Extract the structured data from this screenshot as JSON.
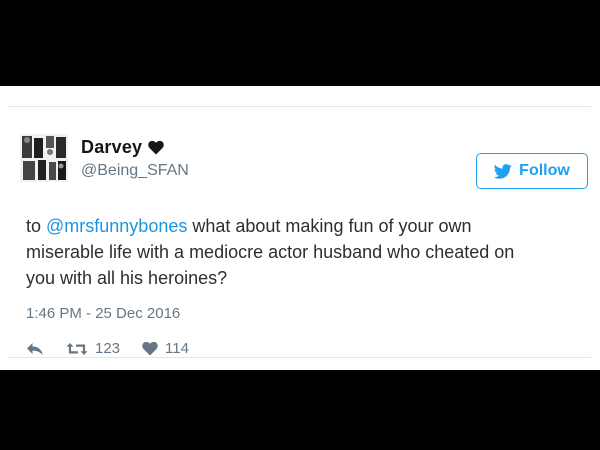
{
  "user": {
    "display_name": "Darvey",
    "handle": "@Being_SFAN",
    "name_icon": "heart-icon",
    "avatar_icon": "avatar-collage"
  },
  "follow_button": {
    "label": "Follow",
    "icon": "bird-icon"
  },
  "tweet": {
    "prefix": "to ",
    "mention": "@mrsfunnybones",
    "body": " what about making fun of your own miserable life with a mediocre actor husband who cheated on you with all his heroines?",
    "timestamp": "1:46 PM - 25 Dec 2016"
  },
  "actions": {
    "reply_icon": "reply-icon",
    "retweet_icon": "retweet-icon",
    "retweet_count": "123",
    "like_icon": "heart-icon",
    "like_count": "114"
  },
  "colors": {
    "link_blue": "#1b95e0",
    "follow_blue": "#1da1f2",
    "text": "#292f33",
    "muted": "#657786",
    "frame": "#000000"
  }
}
